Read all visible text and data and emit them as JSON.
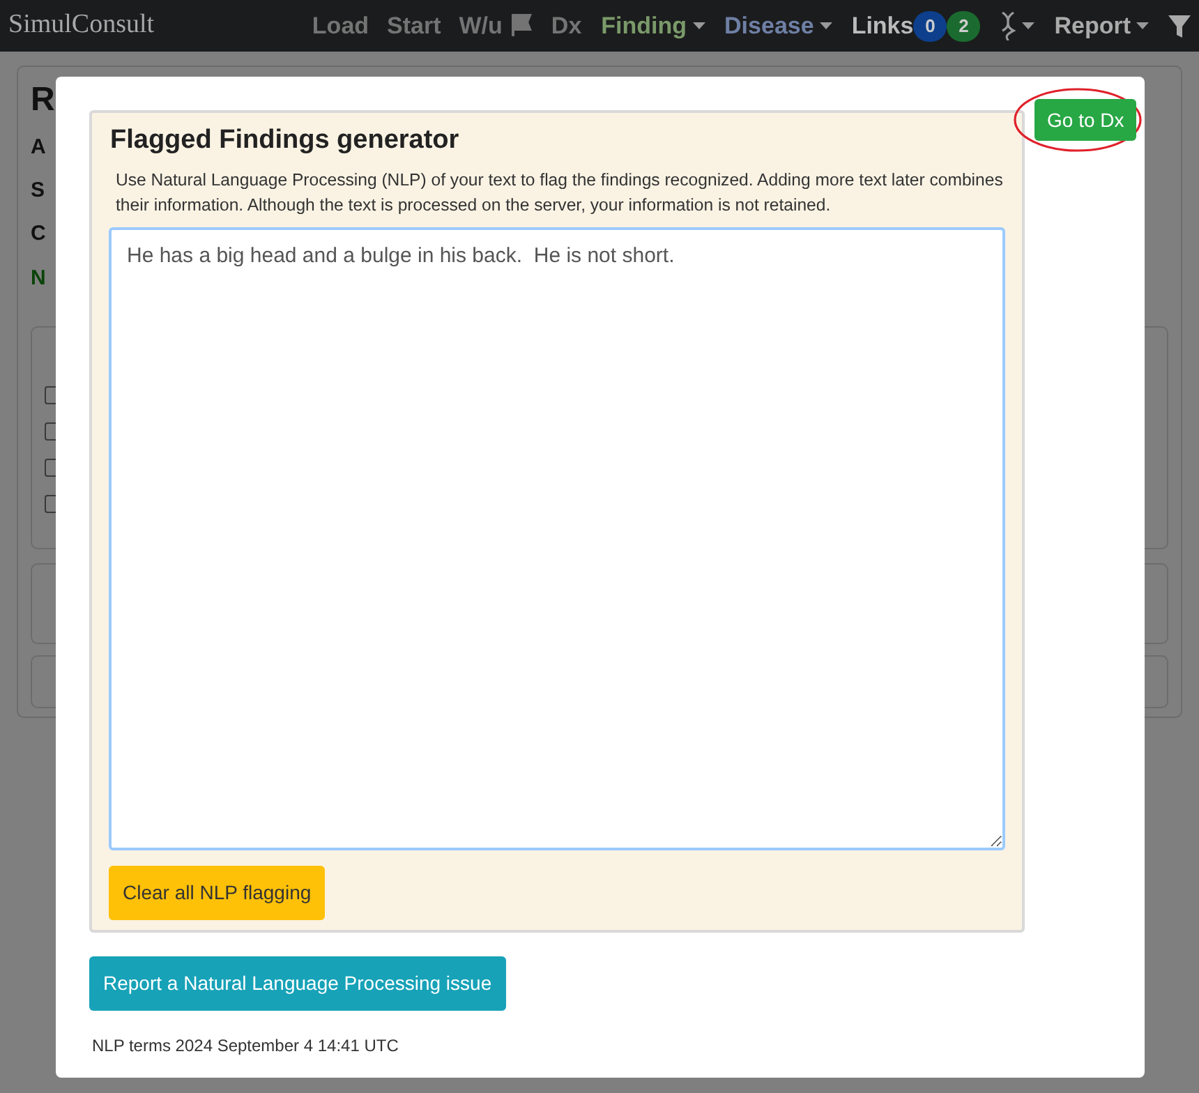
{
  "navbar": {
    "logo": "SimulConsult",
    "items": [
      {
        "label": "Load",
        "kind": "text",
        "disabled": true
      },
      {
        "label": "Start",
        "kind": "text",
        "disabled": true
      },
      {
        "label": "W/u",
        "kind": "text",
        "disabled": true
      },
      {
        "kind": "flag",
        "disabled": true
      },
      {
        "label": "Dx",
        "kind": "text",
        "disabled": true
      },
      {
        "label": "Finding",
        "kind": "menu",
        "color": "#7a9a6a"
      },
      {
        "label": "Disease",
        "kind": "menu",
        "color": "#6f80a6"
      },
      {
        "label": "Links",
        "kind": "links",
        "badges": [
          {
            "text": "0",
            "color": "#0d3f8c"
          },
          {
            "text": "2",
            "color": "#1b6b30"
          }
        ]
      },
      {
        "kind": "dna"
      },
      {
        "label": "Report",
        "kind": "menu",
        "color": "#aaaaaa"
      },
      {
        "kind": "filter"
      }
    ]
  },
  "background": {
    "title": "R",
    "fields": [
      "A",
      "S",
      "C"
    ],
    "link": "N",
    "panels": [
      {
        "checkboxes": [
          {
            "checked": false
          },
          {
            "checked": false
          },
          {
            "checked": false
          },
          {
            "checked": false
          }
        ]
      }
    ]
  },
  "modal": {
    "go_button": "Go to Dx",
    "go_highlighted": true,
    "generator": {
      "title": "Flagged Findings generator",
      "description": "Use Natural Language Processing (NLP) of your text to flag the findings recognized. Adding more text later combines their information.  Although the text is processed on the server, your information is not retained.",
      "text": "He has a big head and a bulge in his back.  He is not short.",
      "clear_button": "Clear all NLP flagging"
    },
    "report_button": "Report a Natural Language Processing issue",
    "footer": "NLP terms 2024 September 4 14:41 UTC"
  }
}
